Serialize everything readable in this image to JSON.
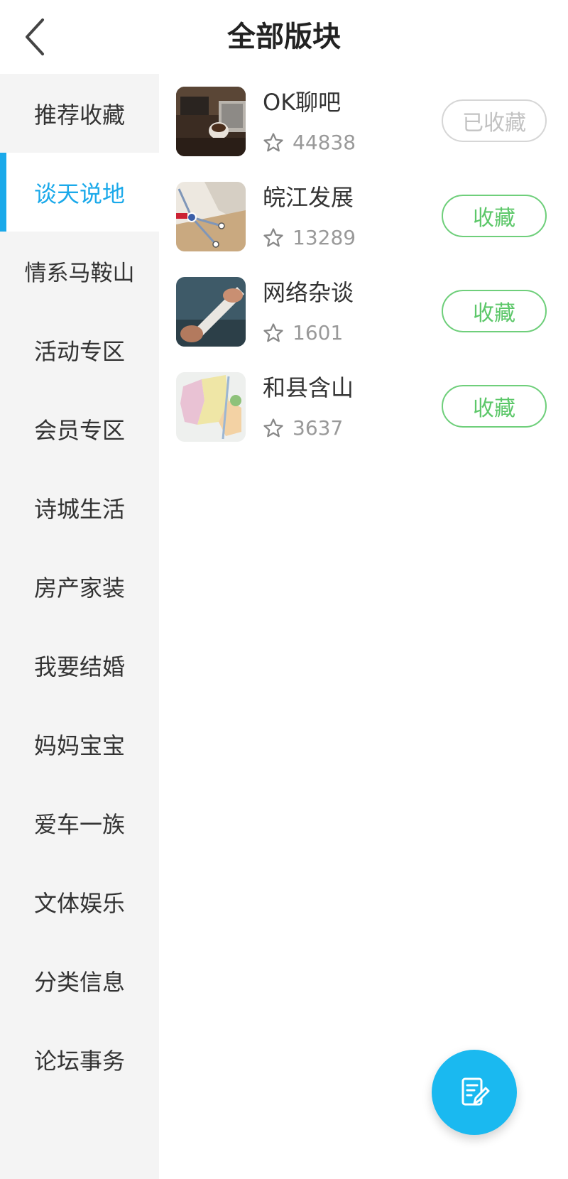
{
  "header": {
    "title": "全部版块",
    "back_icon": "chevron-left-icon"
  },
  "sidebar": {
    "items": [
      {
        "label": "推荐收藏"
      },
      {
        "label": "谈天说地",
        "active": true
      },
      {
        "label": "情系马鞍山"
      },
      {
        "label": "活动专区"
      },
      {
        "label": "会员专区"
      },
      {
        "label": "诗城生活"
      },
      {
        "label": "房产家装"
      },
      {
        "label": "我要结婚"
      },
      {
        "label": "妈妈宝宝"
      },
      {
        "label": "爱车一族"
      },
      {
        "label": "文体娱乐"
      },
      {
        "label": "分类信息"
      },
      {
        "label": "论坛事务"
      }
    ],
    "active_color": "#1aa9ea"
  },
  "forums": [
    {
      "name": "OK聊吧",
      "count": "44838",
      "button": "已收藏",
      "collected": true
    },
    {
      "name": "皖江发展",
      "count": "13289",
      "button": "收藏",
      "collected": false
    },
    {
      "name": "网络杂谈",
      "count": "1601",
      "button": "收藏",
      "collected": false
    },
    {
      "name": "和县含山",
      "count": "3637",
      "button": "收藏",
      "collected": false
    }
  ],
  "fab": {
    "icon": "edit-post-icon",
    "color": "#1ab9f0"
  },
  "colors": {
    "collect_green": "#5cc769",
    "collected_gray": "#c2c2c2"
  }
}
